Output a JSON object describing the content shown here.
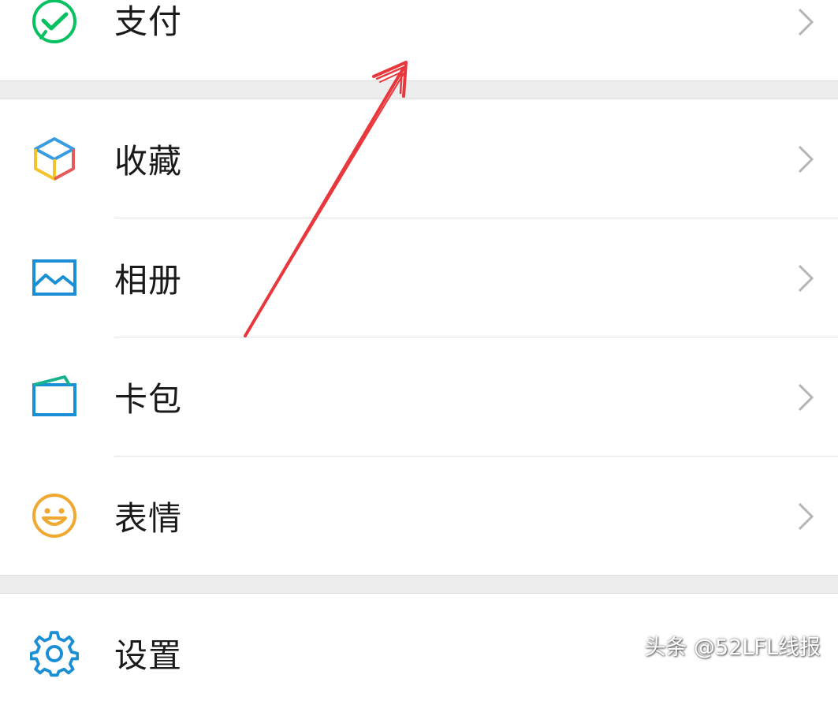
{
  "menu": {
    "pay": {
      "label": "支付",
      "icon": "wechat-pay-icon",
      "color": "#07c160"
    },
    "favorites": {
      "label": "收藏",
      "icon": "cube-icon"
    },
    "album": {
      "label": "相册",
      "icon": "picture-icon",
      "color": "#1a8fd6"
    },
    "cards": {
      "label": "卡包",
      "icon": "wallet-icon",
      "color": "#1a8fd6"
    },
    "stickers": {
      "label": "表情",
      "icon": "smiley-icon",
      "color": "#f0a830"
    },
    "settings": {
      "label": "设置",
      "icon": "gear-icon",
      "color": "#1a8fd6"
    }
  },
  "watermark": {
    "text": "头条 @52LFL线报"
  },
  "annotation": {
    "arrow_color": "#e8383d"
  }
}
